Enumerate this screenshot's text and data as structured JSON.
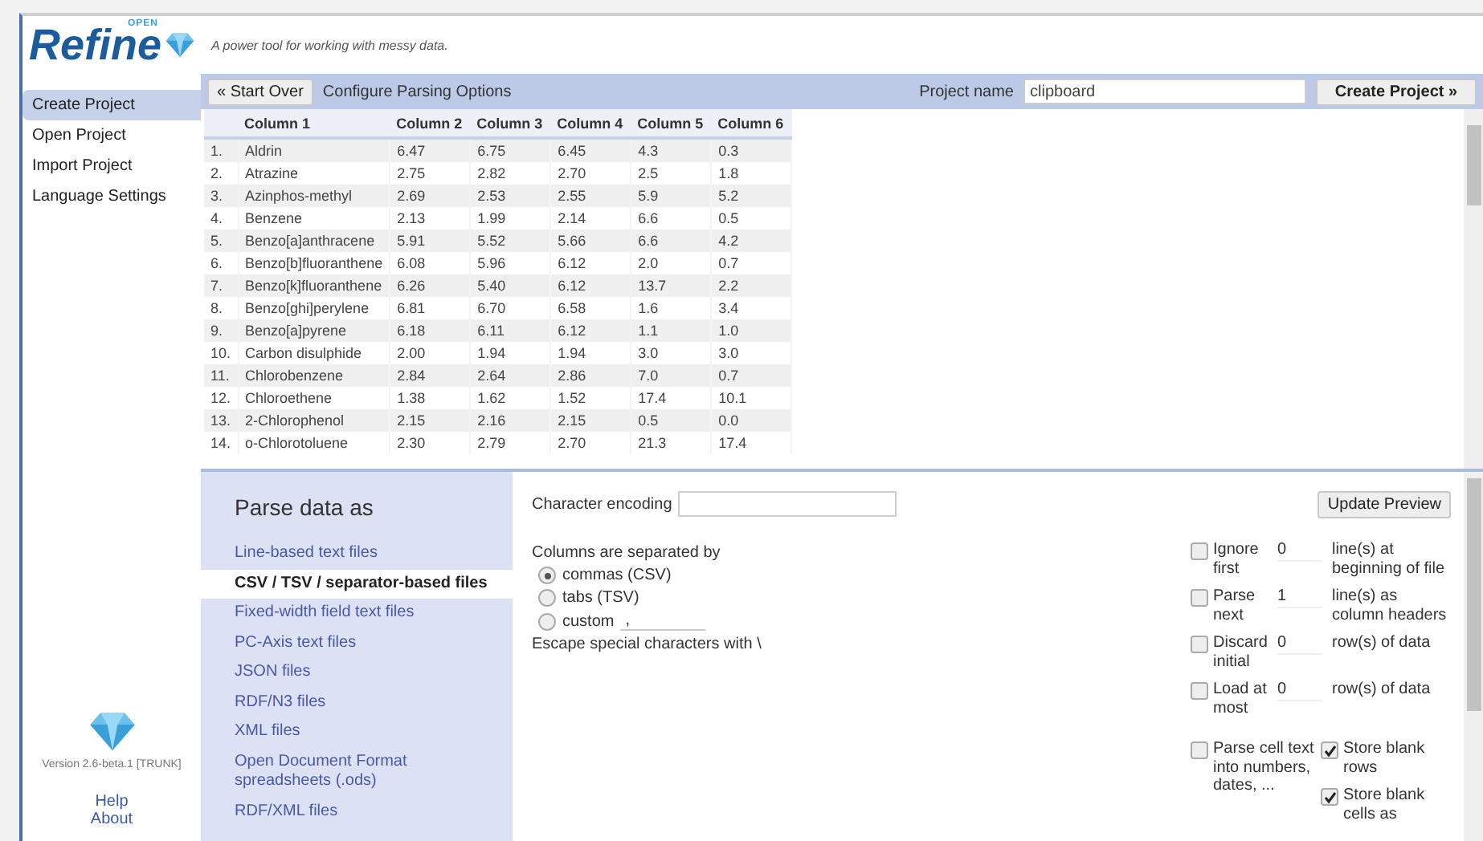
{
  "header": {
    "logo_badge": "OPEN",
    "logo_text": "Refine",
    "tagline": "A power tool for working with messy data."
  },
  "sidebar": {
    "items": [
      {
        "label": "Create Project",
        "selected": true
      },
      {
        "label": "Open Project",
        "selected": false
      },
      {
        "label": "Import Project",
        "selected": false
      },
      {
        "label": "Language Settings",
        "selected": false
      }
    ],
    "version": "Version 2.6-beta.1 [TRUNK]",
    "links": [
      "Help",
      "About"
    ]
  },
  "toolbar": {
    "start_over": "« Start Over",
    "title": "Configure Parsing Options",
    "project_name_label": "Project name",
    "project_name": "clipboard",
    "create_button": "Create Project »"
  },
  "preview": {
    "columns": [
      "",
      "Column 1",
      "Column 2",
      "Column 3",
      "Column 4",
      "Column 5",
      "Column 6"
    ],
    "rows": [
      [
        "1.",
        "Aldrin",
        "6.47",
        "6.75",
        "6.45",
        "4.3",
        "0.3"
      ],
      [
        "2.",
        "Atrazine",
        "2.75",
        "2.82",
        "2.70",
        "2.5",
        "1.8"
      ],
      [
        "3.",
        "Azinphos-methyl",
        "2.69",
        "2.53",
        "2.55",
        "5.9",
        "5.2"
      ],
      [
        "4.",
        "Benzene",
        "2.13",
        "1.99",
        "2.14",
        "6.6",
        "0.5"
      ],
      [
        "5.",
        "Benzo[a]anthracene",
        "5.91",
        "5.52",
        "5.66",
        "6.6",
        "4.2"
      ],
      [
        "6.",
        "Benzo[b]fluoranthene",
        "6.08",
        "5.96",
        "6.12",
        "2.0",
        "0.7"
      ],
      [
        "7.",
        "Benzo[k]fluoranthene",
        "6.26",
        "5.40",
        "6.12",
        "13.7",
        "2.2"
      ],
      [
        "8.",
        "Benzo[ghi]perylene",
        "6.81",
        "6.70",
        "6.58",
        "1.6",
        "3.4"
      ],
      [
        "9.",
        "Benzo[a]pyrene",
        "6.18",
        "6.11",
        "6.12",
        "1.1",
        "1.0"
      ],
      [
        "10.",
        "Carbon disulphide",
        "2.00",
        "1.94",
        "1.94",
        "3.0",
        "3.0"
      ],
      [
        "11.",
        "Chlorobenzene",
        "2.84",
        "2.64",
        "2.86",
        "7.0",
        "0.7"
      ],
      [
        "12.",
        "Chloroethene",
        "1.38",
        "1.62",
        "1.52",
        "17.4",
        "10.1"
      ],
      [
        "13.",
        "2-Chlorophenol",
        "2.15",
        "2.16",
        "2.15",
        "0.5",
        "0.0"
      ],
      [
        "14.",
        "o-Chlorotoluene",
        "2.30",
        "2.79",
        "2.70",
        "21.3",
        "17.4"
      ]
    ]
  },
  "formats": {
    "title": "Parse data as",
    "items": [
      {
        "label": "Line-based text files",
        "selected": false
      },
      {
        "label": "CSV / TSV / separator-based files",
        "selected": true
      },
      {
        "label": "Fixed-width field text files",
        "selected": false
      },
      {
        "label": "PC-Axis text files",
        "selected": false
      },
      {
        "label": "JSON files",
        "selected": false
      },
      {
        "label": "RDF/N3 files",
        "selected": false
      },
      {
        "label": "XML files",
        "selected": false
      },
      {
        "label": "Open Document Format spreadsheets (.ods)",
        "selected": false
      },
      {
        "label": "RDF/XML files",
        "selected": false
      }
    ]
  },
  "options": {
    "encoding_label": "Character encoding",
    "separator_label": "Columns are separated by",
    "separators": [
      {
        "label": "commas (CSV)",
        "selected": true
      },
      {
        "label": "tabs (TSV)",
        "selected": false
      },
      {
        "label": "custom",
        "selected": false,
        "value": ","
      }
    ],
    "escape_label": "Escape special characters with \\",
    "update_button": "Update Preview",
    "line_options": [
      {
        "label": "Ignore first",
        "value": "0",
        "suffix": "line(s) at beginning of file",
        "checked": false
      },
      {
        "label": "Parse next",
        "value": "1",
        "suffix": "line(s) as column headers",
        "checked": false
      },
      {
        "label": "Discard initial",
        "value": "0",
        "suffix": "row(s) of data",
        "checked": false
      },
      {
        "label": "Load at most",
        "value": "0",
        "suffix": "row(s) of data",
        "checked": false
      }
    ],
    "flags": [
      {
        "label": "Parse cell text into numbers, dates, ...",
        "checked": false
      },
      {
        "label": "Store blank rows",
        "checked": true
      },
      {
        "label": "Store blank cells as",
        "checked": true
      }
    ]
  }
}
